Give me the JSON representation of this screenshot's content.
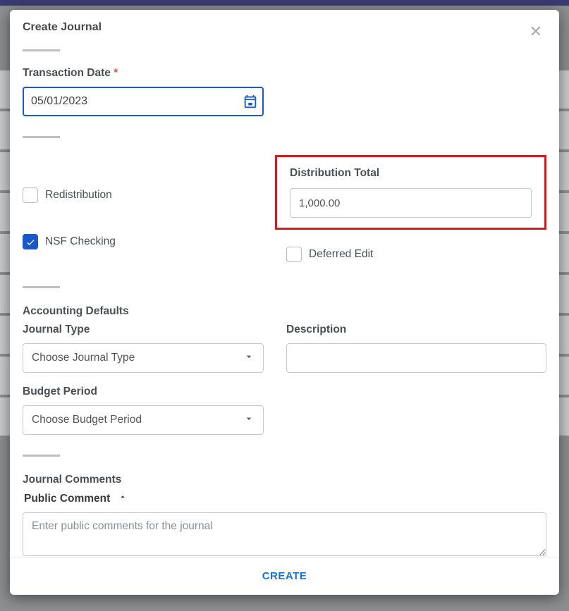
{
  "dialog": {
    "title": "Create Journal",
    "close_label": "Close"
  },
  "transaction_date": {
    "label": "Transaction Date",
    "required_marker": "*",
    "value": "05/01/2023"
  },
  "options": {
    "redistribution": {
      "label": "Redistribution",
      "checked": false
    },
    "nsf_checking": {
      "label": "NSF Checking",
      "checked": true
    },
    "deferred_edit": {
      "label": "Deferred Edit",
      "checked": false
    }
  },
  "distribution_total": {
    "label": "Distribution Total",
    "value": "1,000.00"
  },
  "accounting_defaults": {
    "heading": "Accounting Defaults",
    "journal_type": {
      "label": "Journal Type",
      "placeholder": "Choose Journal Type",
      "value": ""
    },
    "budget_period": {
      "label": "Budget Period",
      "placeholder": "Choose Budget Period",
      "value": ""
    },
    "description": {
      "label": "Description",
      "value": ""
    }
  },
  "journal_comments": {
    "heading": "Journal Comments",
    "public_comment": {
      "label": "Public Comment",
      "expanded": true,
      "placeholder": "Enter public comments for the journal",
      "value": ""
    }
  },
  "footer": {
    "create_label": "CREATE"
  },
  "colors": {
    "accent": "#1a5bc4",
    "highlight_border": "#cc1f1f"
  }
}
